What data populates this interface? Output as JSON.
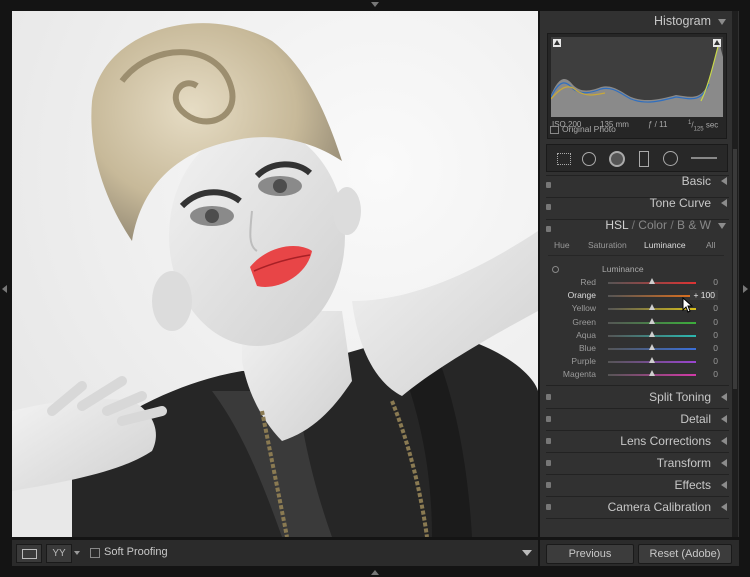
{
  "histogram": {
    "title": "Histogram",
    "iso": "ISO 200",
    "focal": "135 mm",
    "aperture": "ƒ / 11",
    "shutter_num": "1",
    "shutter_den": "125",
    "shutter_unit": "sec",
    "original_photo_label": "Original Photo"
  },
  "panels": {
    "basic": "Basic",
    "tone_curve": "Tone Curve",
    "hsl_label": "HSL",
    "color_label": "Color",
    "bw_label": "B & W",
    "split_toning": "Split Toning",
    "detail": "Detail",
    "lens_corrections": "Lens Corrections",
    "transform": "Transform",
    "effects": "Effects",
    "camera_calibration": "Camera Calibration"
  },
  "hsl_tabs": [
    "Hue",
    "Saturation",
    "Luminance",
    "All"
  ],
  "luminance": {
    "section_title": "Luminance",
    "sliders": [
      {
        "label": "Red",
        "value": "0",
        "position": 0.5,
        "color": "#d33"
      },
      {
        "label": "Orange",
        "value": "+ 100",
        "position": 1.0,
        "color": "#e0701c"
      },
      {
        "label": "Yellow",
        "value": "0",
        "position": 0.5,
        "color": "#d8c01c"
      },
      {
        "label": "Green",
        "value": "0",
        "position": 0.5,
        "color": "#3cae3c"
      },
      {
        "label": "Aqua",
        "value": "0",
        "position": 0.5,
        "color": "#2cb8b0"
      },
      {
        "label": "Blue",
        "value": "0",
        "position": 0.5,
        "color": "#3a6fd8"
      },
      {
        "label": "Purple",
        "value": "0",
        "position": 0.5,
        "color": "#9a45d0"
      },
      {
        "label": "Magenta",
        "value": "0",
        "position": 0.5,
        "color": "#d23aa8"
      }
    ]
  },
  "toolbar": {
    "soft_proofing": "Soft Proofing",
    "yy_label": "YY"
  },
  "footer": {
    "previous": "Previous",
    "reset": "Reset (Adobe)"
  }
}
